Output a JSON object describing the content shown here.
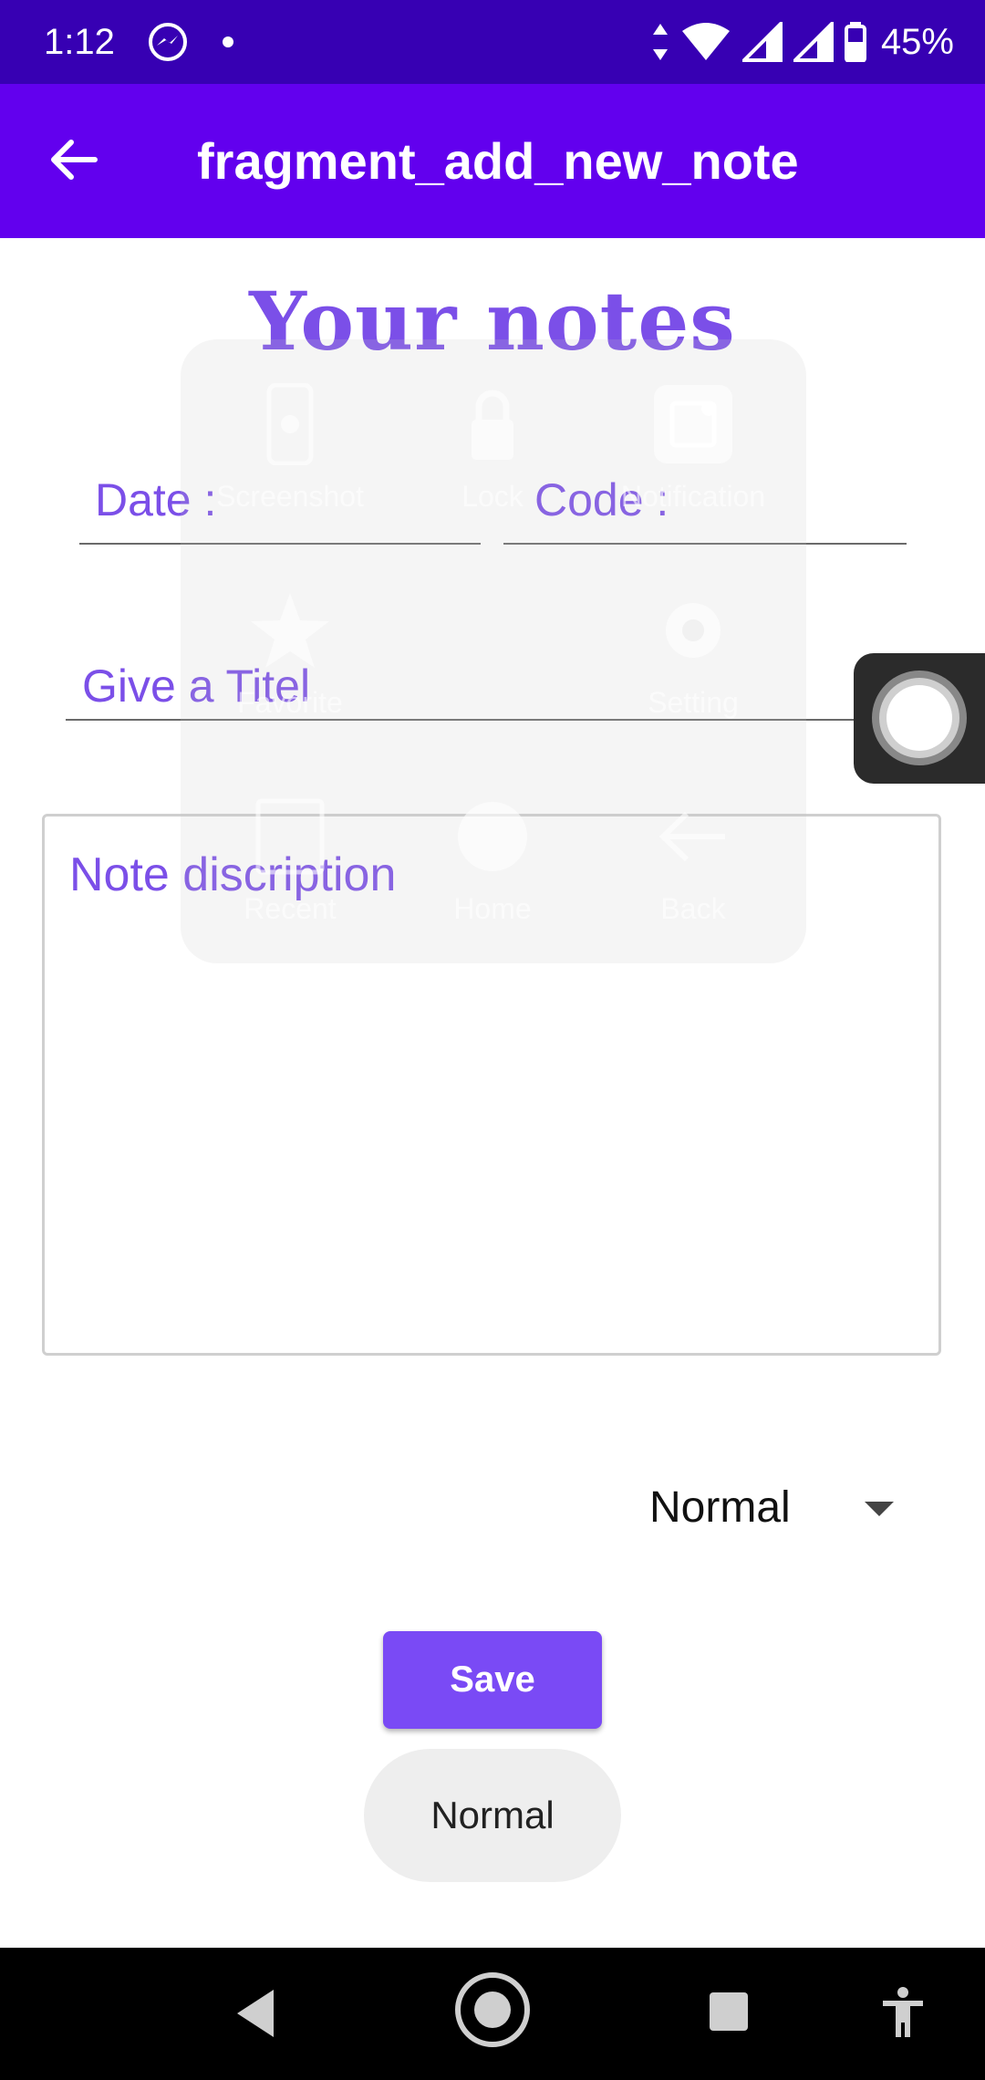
{
  "status_bar": {
    "time": "1:12",
    "battery_percent": "45%",
    "icons": [
      "messenger-icon",
      "notification-dot",
      "data-arrows-icon",
      "wifi-icon",
      "signal-icon",
      "signal-icon",
      "battery-icon"
    ]
  },
  "app_bar": {
    "back_icon": "arrow-back-icon",
    "title": "fragment_add_new_note"
  },
  "heading": "Your notes",
  "form": {
    "date_label": "Date :",
    "code_label": "Code :",
    "title_placeholder": "Give a Titel",
    "description_placeholder": "Note discription"
  },
  "spinner": {
    "selected": "Normal"
  },
  "save_label": "Save",
  "toast": "Normal",
  "assistive_menu": {
    "items": [
      "Screenshot",
      "Lock",
      "Notification",
      "Favorite",
      "Setting",
      "Recent",
      "Home",
      "Back"
    ]
  },
  "colors": {
    "status_bar": "#3700b3",
    "app_bar": "#6200ee",
    "accent": "#7b4fe8",
    "button": "#7a4af5"
  }
}
